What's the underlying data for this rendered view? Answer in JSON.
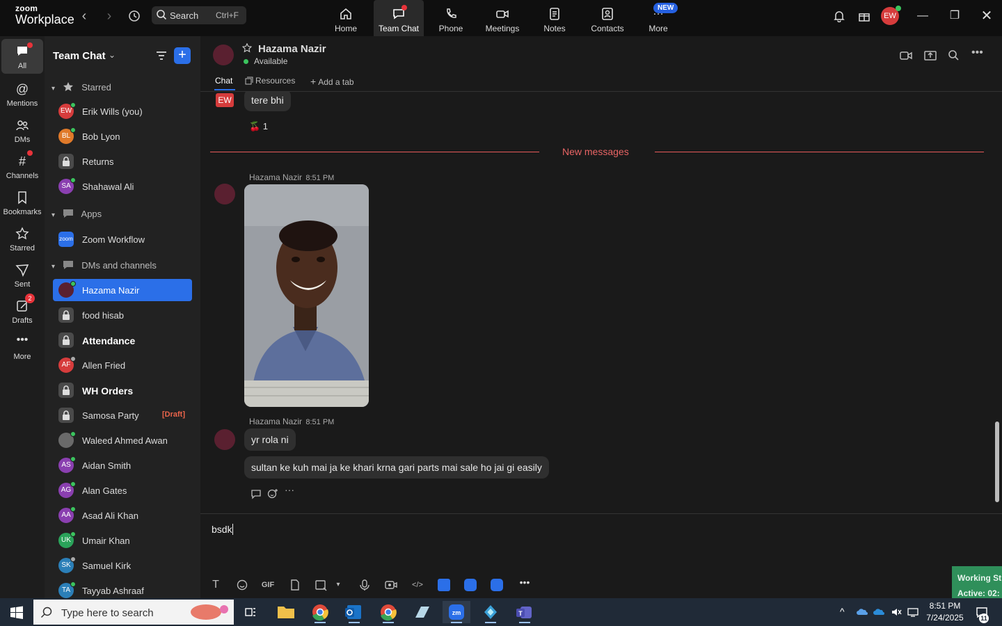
{
  "app": {
    "brand_top": "zoom",
    "brand_bottom": "Workplace"
  },
  "search": {
    "label": "Search",
    "shortcut": "Ctrl+F"
  },
  "top_nav": [
    {
      "label": "Home",
      "icon": "home-icon"
    },
    {
      "label": "Team Chat",
      "icon": "team-chat-icon"
    },
    {
      "label": "Phone",
      "icon": "phone-icon"
    },
    {
      "label": "Meetings",
      "icon": "meetings-icon"
    },
    {
      "label": "Notes",
      "icon": "notes-icon"
    },
    {
      "label": "Contacts",
      "icon": "contacts-icon"
    },
    {
      "label": "More",
      "icon": "more-icon"
    }
  ],
  "top_new_badge": "NEW",
  "user_avatar": "EW",
  "rail": [
    {
      "label": "All",
      "icon": "chat-bubble-icon"
    },
    {
      "label": "Mentions",
      "icon": "at-icon"
    },
    {
      "label": "DMs",
      "icon": "people-icon"
    },
    {
      "label": "Channels",
      "icon": "hash-icon"
    },
    {
      "label": "Bookmarks",
      "icon": "bookmark-icon"
    },
    {
      "label": "Starred",
      "icon": "star-icon"
    },
    {
      "label": "Sent",
      "icon": "send-icon"
    },
    {
      "label": "Drafts",
      "icon": "draft-icon",
      "badge": "2"
    },
    {
      "label": "More",
      "icon": "ellipsis-icon"
    }
  ],
  "sidebar": {
    "title": "Team Chat",
    "sections": {
      "starred": "Starred",
      "apps": "Apps",
      "dms": "DMs and channels"
    },
    "starred": [
      {
        "name": "Erik Wills (you)",
        "initials": "EW",
        "color": "#d63c3c",
        "status": "online"
      },
      {
        "name": "Bob Lyon",
        "initials": "BL",
        "color": "#e07a2a",
        "status": "online"
      },
      {
        "name": "Returns",
        "type": "lock"
      },
      {
        "name": "Shahawal Ali",
        "initials": "SA",
        "color": "#8a3fb0",
        "status": "online"
      }
    ],
    "apps": [
      {
        "name": "Zoom Workflow",
        "initials": "zoom",
        "color": "#2b6fe8"
      }
    ],
    "dms": [
      {
        "name": "Hazama Nazir",
        "type": "avatar",
        "color": "#5a2030",
        "status": "online",
        "selected": true
      },
      {
        "name": "food hisab",
        "type": "lock"
      },
      {
        "name": "Attendance",
        "type": "lock",
        "bold": true
      },
      {
        "name": "Allen Fried",
        "initials": "AF",
        "color": "#d63c3c",
        "status": "away"
      },
      {
        "name": "WH Orders",
        "type": "lock",
        "bold": true
      },
      {
        "name": "Samosa Party",
        "type": "lock",
        "draft": "[Draft]"
      },
      {
        "name": "Waleed Ahmed Awan",
        "type": "photo",
        "color": "#6a6a6a",
        "status": "online"
      },
      {
        "name": "Aidan Smith",
        "initials": "AS",
        "color": "#8a3fb0",
        "status": "online"
      },
      {
        "name": "Alan Gates",
        "initials": "AG",
        "color": "#8a3fb0",
        "status": "online"
      },
      {
        "name": "Asad Ali Khan",
        "initials": "AA",
        "color": "#8a3fb0",
        "status": "online"
      },
      {
        "name": "Umair Khan",
        "initials": "UK",
        "color": "#2aa35a",
        "status": "online"
      },
      {
        "name": "Samuel Kirk",
        "initials": "SK",
        "color": "#2b7fb8",
        "status": "away"
      },
      {
        "name": "Tayyab Ashraaf",
        "initials": "TA",
        "color": "#2b7fb8",
        "status": "online"
      }
    ]
  },
  "channel": {
    "name": "Hazama Nazir",
    "status": "Available",
    "tabs": [
      "Chat",
      "Resources",
      "Add a tab"
    ]
  },
  "messages": {
    "prev_sender_initials": "EW",
    "prev_text": "tere bhi",
    "prev_reaction": "🍒 1",
    "new_messages_label": "New messages",
    "group1_sender": "Hazama Nazir",
    "group1_time": "8:51 PM",
    "group2_sender": "Hazama Nazir",
    "group2_time": "8:51 PM",
    "msg1": "yr rola ni",
    "msg2": "sultan ke kuh mai ja ke khari krna gari parts mai sale ho jai gi easily"
  },
  "composer": {
    "value": "bsdk",
    "tools": [
      "text-format-icon",
      "emoji-icon",
      "gif-icon",
      "file-icon",
      "screenshot-icon",
      "chevron-down-icon",
      "mic-icon",
      "video-clip-icon",
      "code-icon",
      "app-icon-1",
      "app-icon-2",
      "app-icon-3",
      "ellipsis-icon"
    ],
    "gif_label": "GIF"
  },
  "widget": {
    "line1": "Working St",
    "line2": "Active: 02:"
  },
  "taskbar": {
    "search_placeholder": "Type here to search",
    "time": "8:51 PM",
    "date": "7/24/2025",
    "notifications": "11"
  },
  "colors": {
    "accent": "#2b6fe8",
    "online": "#3bc45e",
    "new_messages": "#e86464",
    "draft": "#e8634a"
  }
}
